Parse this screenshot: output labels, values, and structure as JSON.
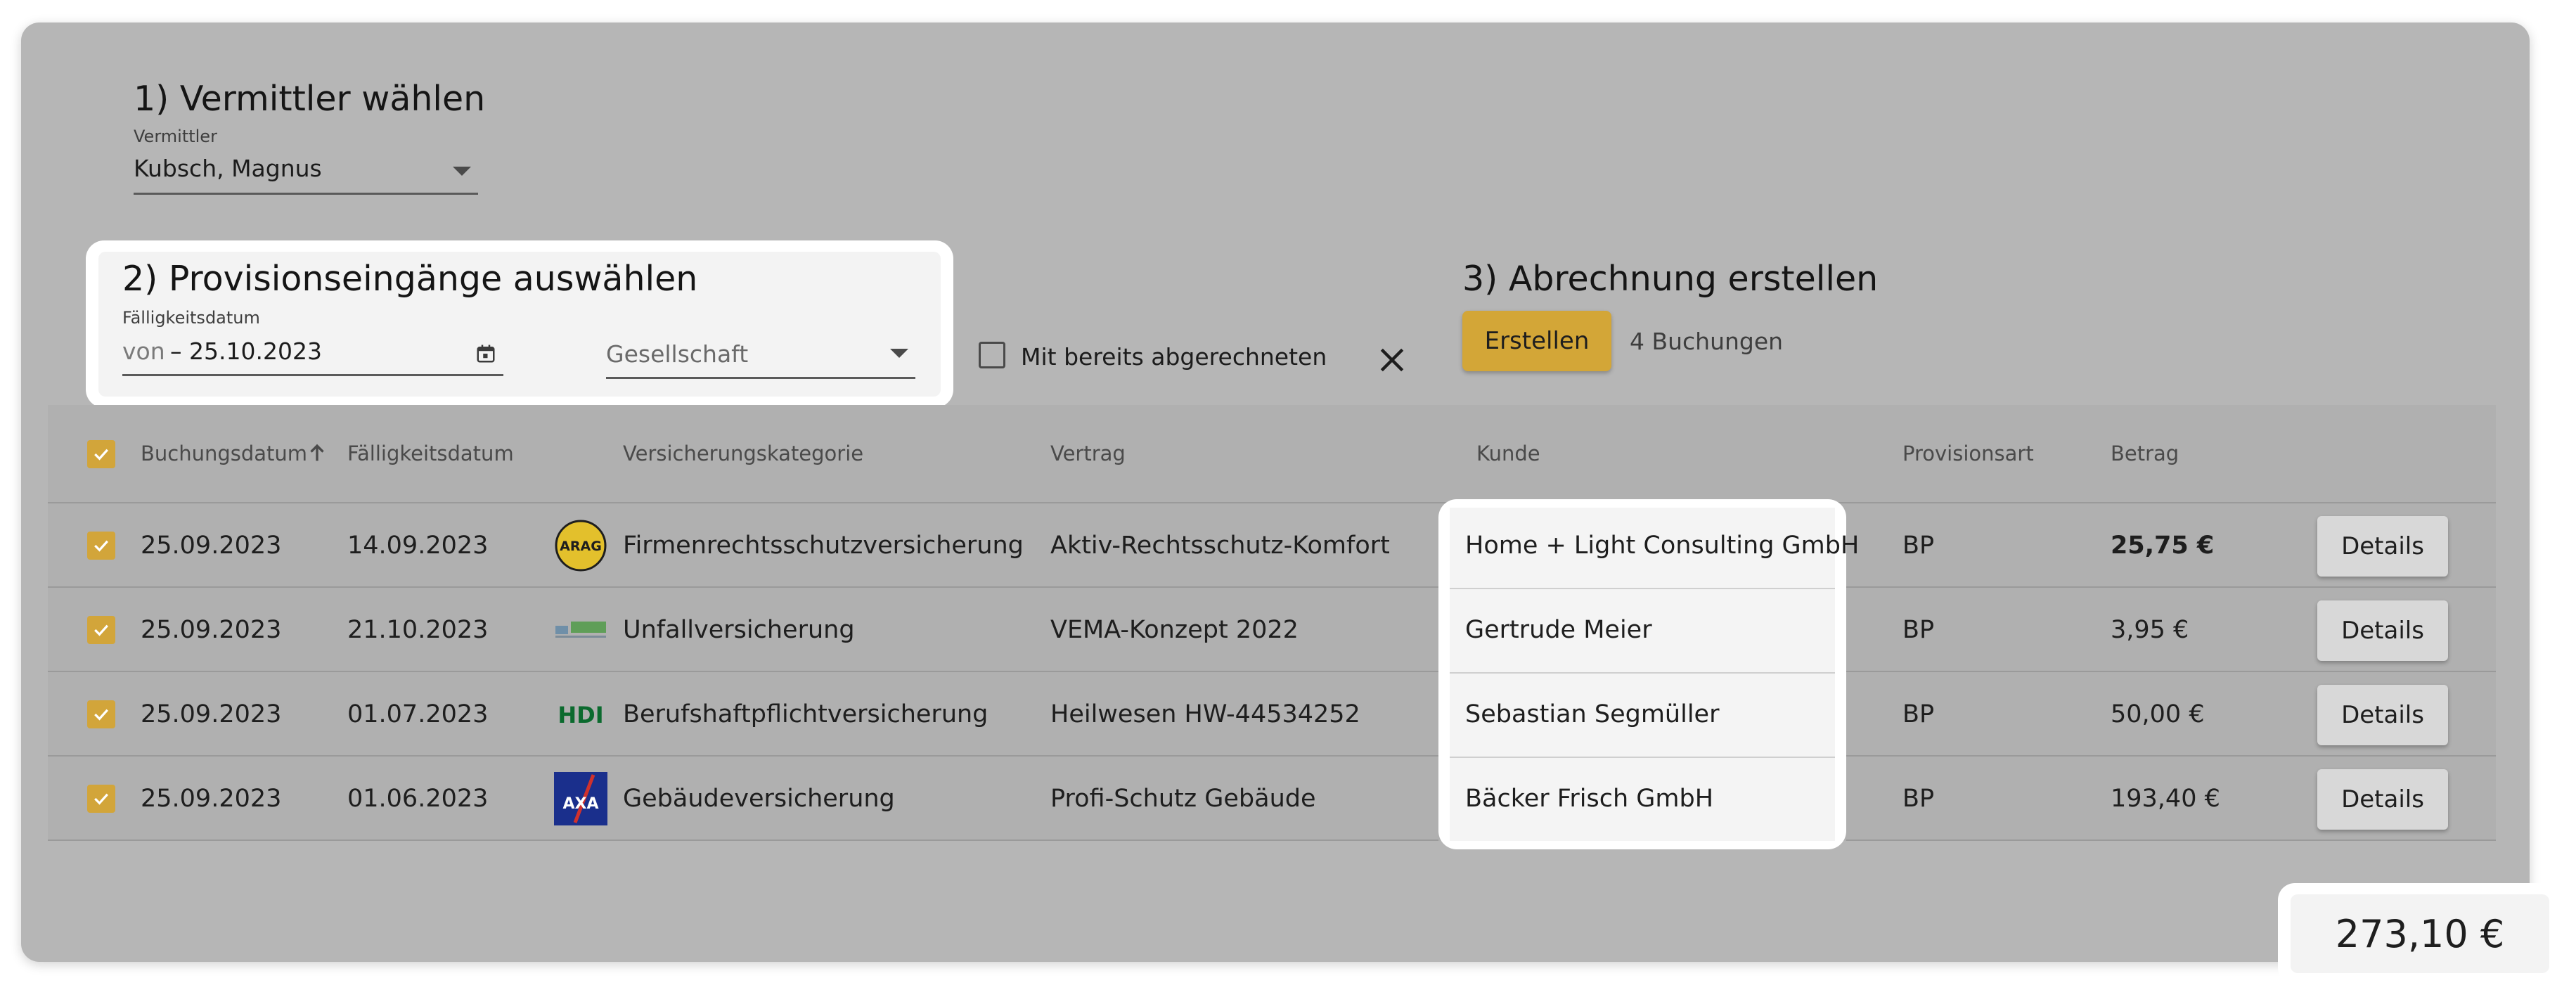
{
  "step1": {
    "title": "1) Vermittler wählen",
    "field_label": "Vermittler",
    "field_value": "Kubsch, Magnus"
  },
  "step2": {
    "title": "2) Provisionseingänge auswählen",
    "date_label": "Fälligkeitsdatum",
    "date_prefix": "von",
    "date_value": "– 25.10.2023",
    "company_placeholder": "Gesellschaft",
    "already_settled_label": "Mit bereits abgerechneten"
  },
  "step3": {
    "title": "3) Abrechnung erstellen",
    "create_button": "Erstellen",
    "bookings_count": "4 Buchungen"
  },
  "table": {
    "headers": {
      "booking_date": "Buchungsdatum",
      "due_date": "Fälligkeitsdatum",
      "category": "Versicherungskategorie",
      "contract": "Vertrag",
      "customer": "Kunde",
      "commission_type": "Provisionsart",
      "amount": "Betrag"
    },
    "rows": [
      {
        "booking_date": "25.09.2023",
        "due_date": "14.09.2023",
        "logo": "ARAG",
        "category": "Firmenrechtsschutzversicherung",
        "contract": "Aktiv-Rechtsschutz-Komfort",
        "customer": "Home + Light Consulting GmbH",
        "commission_type": "BP",
        "amount": "25,75 €",
        "details": "Details"
      },
      {
        "booking_date": "25.09.2023",
        "due_date": "21.10.2023",
        "logo": "IDEAL",
        "category": "Unfallversicherung",
        "contract": "VEMA-Konzept 2022",
        "customer": "Gertrude Meier",
        "commission_type": "BP",
        "amount": "3,95 €",
        "details": "Details"
      },
      {
        "booking_date": "25.09.2023",
        "due_date": "01.07.2023",
        "logo": "HDI",
        "category": "Berufshaftpflichtversicherung",
        "contract": "Heilwesen HW-44534252",
        "customer": "Sebastian Segmüller",
        "commission_type": "BP",
        "amount": "50,00 €",
        "details": "Details"
      },
      {
        "booking_date": "25.09.2023",
        "due_date": "01.06.2023",
        "logo": "AXA",
        "category": "Gebäudeversicherung",
        "contract": "Profi-Schutz Gebäude",
        "customer": "Bäcker Frisch GmbH",
        "commission_type": "BP",
        "amount": "193,40 €",
        "details": "Details"
      }
    ]
  },
  "total": "273,10 €",
  "colors": {
    "accent": "#d3a637",
    "overlay": "#b6b6b6"
  }
}
